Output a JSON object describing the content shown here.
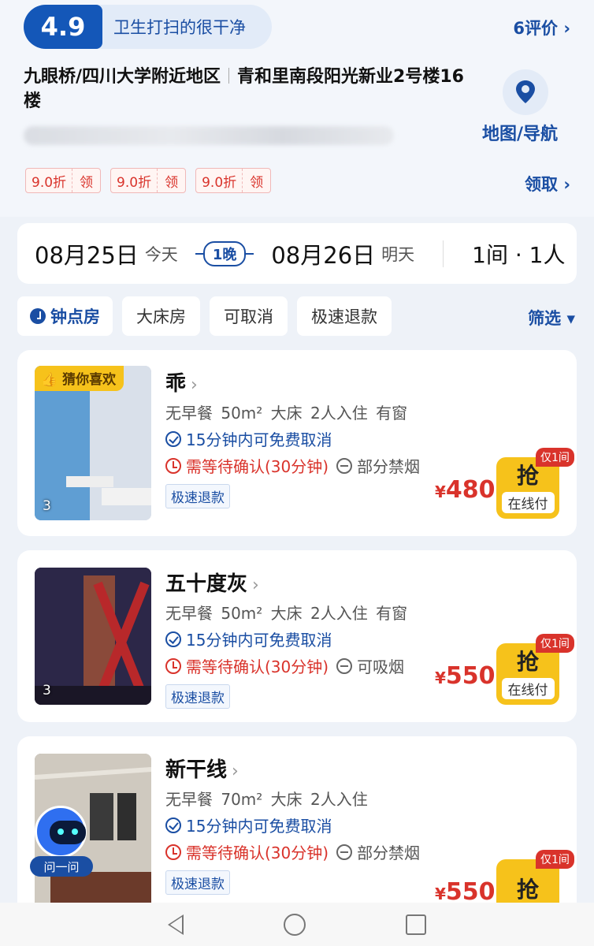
{
  "header": {
    "rating": "4.9",
    "rating_text": "卫生打扫的很干净",
    "reviews": "6评价 ›",
    "address_area": "九眼桥/四川大学附近地区",
    "address_street": "青和里南段阳光新业2号楼16楼",
    "map_label": "地图/导航",
    "coupons": [
      {
        "value": "9.0折",
        "action": "领"
      },
      {
        "value": "9.0折",
        "action": "领"
      },
      {
        "value": "9.0折",
        "action": "领"
      }
    ],
    "claim": "领取 ›"
  },
  "date_bar": {
    "check_in_date": "08月25日",
    "check_in_day": "今天",
    "nights": "1晚",
    "check_out_date": "08月26日",
    "check_out_day": "明天",
    "guests": "1间 · 1人"
  },
  "filters": {
    "chips": [
      "钟点房",
      "大床房",
      "可取消",
      "极速退款"
    ],
    "filter_button": "筛选 ▾"
  },
  "rooms": [
    {
      "badge": "猜你喜欢",
      "photo_count": "3",
      "name": "乖",
      "specs": "无早餐 50m² 大床 2人入住 有窗",
      "cancel": "15分钟内可免费取消",
      "confirm": "需等待确认(30分钟)",
      "smoking": "部分禁烟",
      "refund": "极速退款",
      "currency": "¥",
      "price": "480",
      "only_tag": "仅1间",
      "book_label": "抢",
      "pay_label": "在线付"
    },
    {
      "photo_count": "3",
      "name": "五十度灰",
      "specs": "无早餐 50m² 大床 2人入住 有窗",
      "cancel": "15分钟内可免费取消",
      "confirm": "需等待确认(30分钟)",
      "smoking": "可吸烟",
      "refund": "极速退款",
      "currency": "¥",
      "price": "550",
      "only_tag": "仅1间",
      "book_label": "抢",
      "pay_label": "在线付"
    },
    {
      "name": "新干线",
      "specs": "无早餐 70m² 大床 2人入住",
      "cancel": "15分钟内可免费取消",
      "confirm": "需等待确认(30分钟)",
      "smoking": "部分禁烟",
      "refund": "极速退款",
      "currency": "¥",
      "price": "550",
      "only_tag": "仅1间",
      "book_label": "抢"
    }
  ],
  "assistant": {
    "label": "问一问"
  },
  "icons": {
    "map": "map-pin-icon",
    "clock": "clock-icon",
    "check": "check-circle-icon",
    "timer": "timer-icon",
    "smoke": "no-smoking-icon"
  },
  "colors": {
    "brand": "#1a4ea3",
    "price": "#d9332b",
    "book": "#f6c21b"
  }
}
